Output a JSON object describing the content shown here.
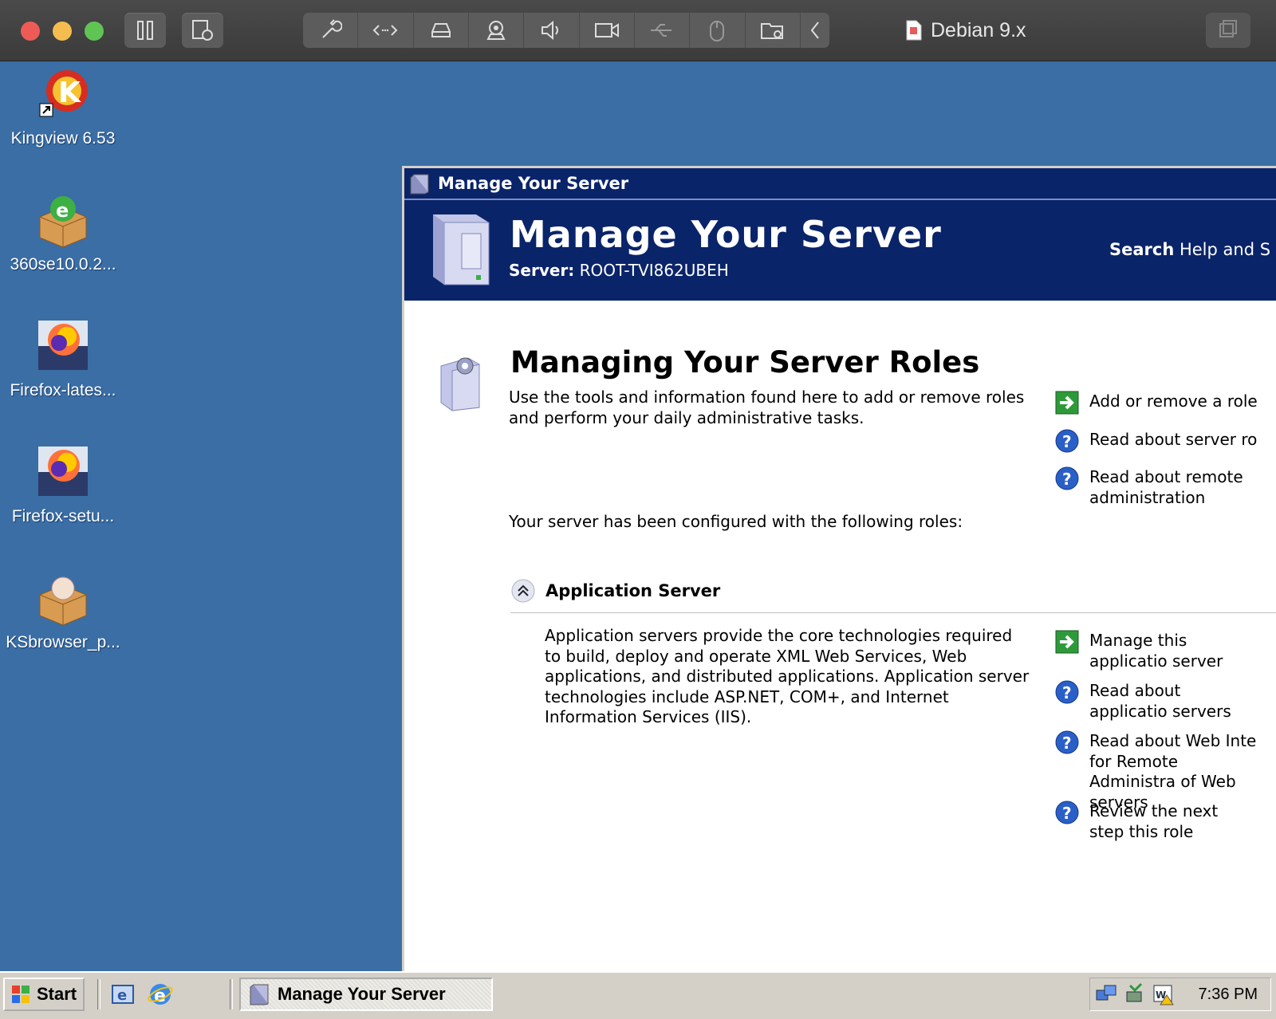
{
  "vm": {
    "title": "Debian 9.x"
  },
  "desktop": {
    "icons": [
      {
        "label": "Kingview 6.53"
      },
      {
        "label": "360se10.0.2..."
      },
      {
        "label": "Firefox-lates..."
      },
      {
        "label": "Firefox-setu..."
      },
      {
        "label": "KSbrowser_p..."
      }
    ]
  },
  "window": {
    "title": "Manage Your Server",
    "header": {
      "title": "Manage Your Server",
      "server_label": "Server:",
      "server_name": "ROOT-TVI862UBEH",
      "search_bold": "Search",
      "search_rest": " Help and S"
    },
    "main": {
      "heading": "Managing Your Server Roles",
      "intro": "Use the tools and information found here to add or remove roles and perform your daily administrative tasks.",
      "configured": "Your server has been configured with the following roles:",
      "role": {
        "name": "Application Server",
        "description": "Application servers provide the core technologies required to build, deploy and operate XML Web Services, Web applications, and distributed applications. Application server technologies include ASP.NET, COM+, and Internet Information Services (IIS)."
      },
      "top_actions": [
        {
          "label": "Add or remove a role",
          "icon": "green-arrow-icon"
        },
        {
          "label": "Read about server ro",
          "icon": "help-icon"
        },
        {
          "label": "Read about remote administration",
          "icon": "help-icon"
        }
      ],
      "role_actions": [
        {
          "label": "Manage this applicatio server",
          "icon": "green-arrow-icon"
        },
        {
          "label": "Read about applicatio servers",
          "icon": "help-icon"
        },
        {
          "label": "Read about Web Inte for Remote Administra of Web servers",
          "icon": "help-icon"
        },
        {
          "label": "Review the next step this role",
          "icon": "help-icon"
        }
      ]
    }
  },
  "taskbar": {
    "start_label": "Start",
    "task_label": "Manage Your Server",
    "clock": "7:36 PM"
  }
}
